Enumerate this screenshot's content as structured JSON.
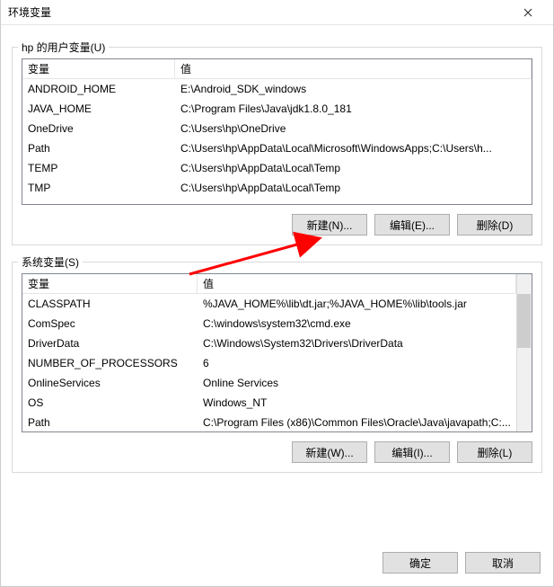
{
  "window": {
    "title": "环境变量"
  },
  "user_vars": {
    "group_label": "hp 的用户变量(U)",
    "columns": {
      "name": "变量",
      "value": "值"
    },
    "rows": [
      {
        "name": "ANDROID_HOME",
        "value": "E:\\Android_SDK_windows"
      },
      {
        "name": "JAVA_HOME",
        "value": "C:\\Program Files\\Java\\jdk1.8.0_181"
      },
      {
        "name": "OneDrive",
        "value": "C:\\Users\\hp\\OneDrive"
      },
      {
        "name": "Path",
        "value": "C:\\Users\\hp\\AppData\\Local\\Microsoft\\WindowsApps;C:\\Users\\h..."
      },
      {
        "name": "TEMP",
        "value": "C:\\Users\\hp\\AppData\\Local\\Temp"
      },
      {
        "name": "TMP",
        "value": "C:\\Users\\hp\\AppData\\Local\\Temp"
      }
    ],
    "buttons": {
      "new": "新建(N)...",
      "edit": "编辑(E)...",
      "delete": "删除(D)"
    }
  },
  "sys_vars": {
    "group_label": "系统变量(S)",
    "columns": {
      "name": "变量",
      "value": "值"
    },
    "rows": [
      {
        "name": "CLASSPATH",
        "value": "%JAVA_HOME%\\lib\\dt.jar;%JAVA_HOME%\\lib\\tools.jar"
      },
      {
        "name": "ComSpec",
        "value": "C:\\windows\\system32\\cmd.exe"
      },
      {
        "name": "DriverData",
        "value": "C:\\Windows\\System32\\Drivers\\DriverData"
      },
      {
        "name": "NUMBER_OF_PROCESSORS",
        "value": "6"
      },
      {
        "name": "OnlineServices",
        "value": "Online Services"
      },
      {
        "name": "OS",
        "value": "Windows_NT"
      },
      {
        "name": "Path",
        "value": "C:\\Program Files (x86)\\Common Files\\Oracle\\Java\\javapath;C:..."
      }
    ],
    "buttons": {
      "new": "新建(W)...",
      "edit": "编辑(I)...",
      "delete": "删除(L)"
    }
  },
  "footer": {
    "ok": "确定",
    "cancel": "取消"
  }
}
